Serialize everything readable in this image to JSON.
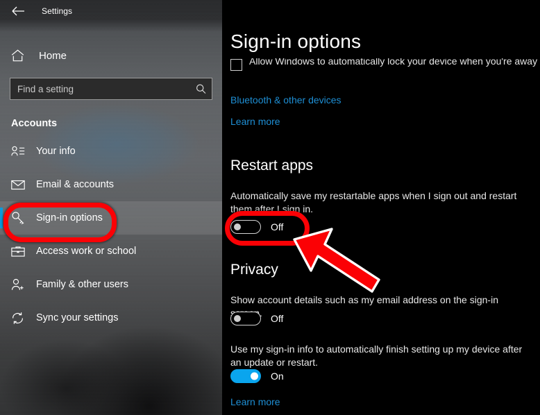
{
  "window": {
    "title": "Settings",
    "back_icon": "back-arrow-icon"
  },
  "sidebar": {
    "home": {
      "label": "Home",
      "icon": "home-icon"
    },
    "search": {
      "placeholder": "Find a setting",
      "value": "",
      "icon": "search-icon"
    },
    "category": "Accounts",
    "items": [
      {
        "label": "Your info",
        "icon": "person-info-icon",
        "selected": false
      },
      {
        "label": "Email & accounts",
        "icon": "envelope-icon",
        "selected": false
      },
      {
        "label": "Sign-in options",
        "icon": "key-icon",
        "selected": true
      },
      {
        "label": "Access work or school",
        "icon": "briefcase-icon",
        "selected": false
      },
      {
        "label": "Family & other users",
        "icon": "person-add-icon",
        "selected": false
      },
      {
        "label": "Sync your settings",
        "icon": "sync-icon",
        "selected": false
      }
    ]
  },
  "main": {
    "page_title": "Sign-in options",
    "clipped_row": {
      "label": "Allow Windows to automatically lock your device when you're away",
      "checked": false,
      "icon": "checkbox-unchecked-icon"
    },
    "links_top": [
      {
        "label": "Bluetooth & other devices"
      },
      {
        "label": "Learn more"
      }
    ],
    "restart_apps": {
      "heading": "Restart apps",
      "description": "Automatically save my restartable apps when I sign out and restart them after I sign in.",
      "toggle": {
        "state": "Off",
        "on": false
      }
    },
    "privacy": {
      "heading": "Privacy",
      "setting_1": {
        "description": "Show account details such as my email address on the sign-in screen.",
        "toggle": {
          "state": "Off",
          "on": false
        }
      },
      "setting_2": {
        "description": "Use my sign-in info to automatically finish setting up my device after an update or restart.",
        "toggle": {
          "state": "On",
          "on": true
        }
      },
      "learn_more": "Learn more"
    }
  },
  "annotations": {
    "highlight_color": "#fb0105",
    "sidebar_highlight_target": "Sign-in options",
    "toggle_highlight_target": "Restart apps toggle",
    "arrow": {
      "icon": "red-arrow-icon",
      "points_to": "Restart apps toggle"
    }
  },
  "colors": {
    "accent": "#0aa5ee",
    "link": "#1e8fd5",
    "selection_bar": "#0a9bdd",
    "content_background": "#000000"
  }
}
